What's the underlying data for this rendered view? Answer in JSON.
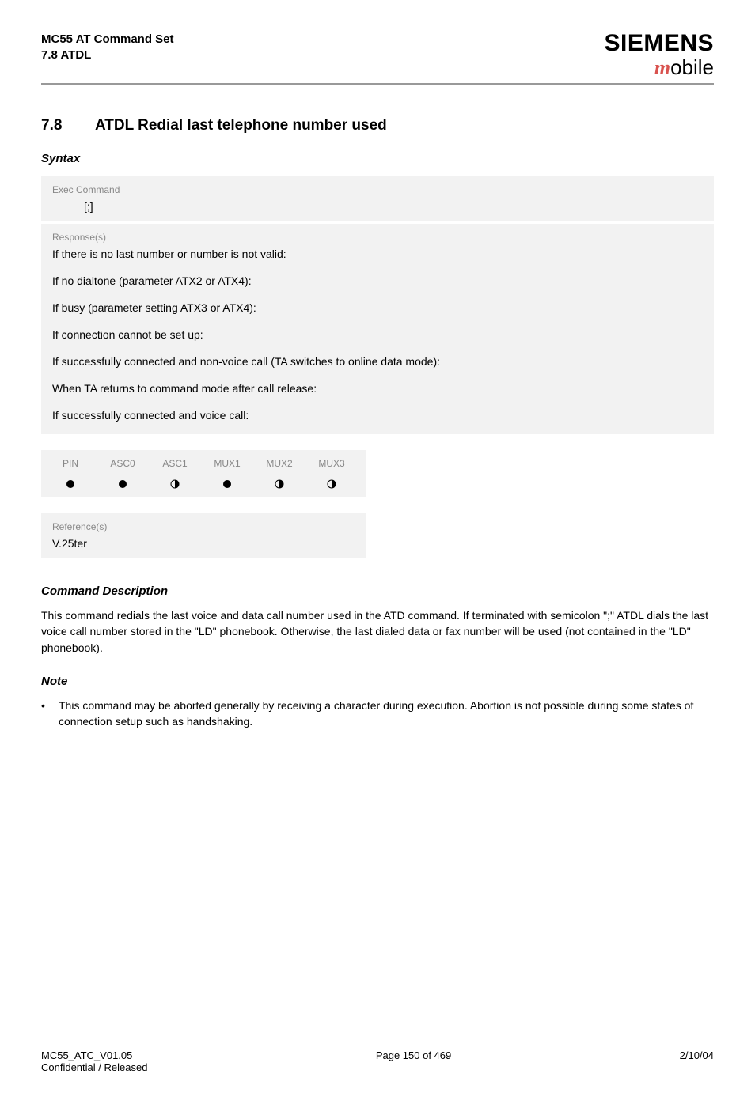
{
  "header": {
    "left_line1": "MC55 AT Command Set",
    "left_line2": "7.8 ATDL",
    "brand": "SIEMENS",
    "subbrand_m": "m",
    "subbrand_rest": "obile"
  },
  "section": {
    "number": "7.8",
    "title": "ATDL   Redial last telephone number used"
  },
  "syntax_label": "Syntax",
  "exec": {
    "label": "Exec Command",
    "cmd": "[;]"
  },
  "response": {
    "label": "Response(s)",
    "lines": [
      "If there is no last number or number is not valid:",
      "If no dialtone (parameter ATX2 or ATX4):",
      "If busy (parameter setting ATX3 or ATX4):",
      "If connection cannot be set up:",
      "If successfully connected and non-voice call (TA switches to online data mode):",
      "When TA returns to command mode after call release:",
      "If successfully connected and voice call:"
    ]
  },
  "channels": {
    "headers": [
      "PIN",
      "ASC0",
      "ASC1",
      "MUX1",
      "MUX2",
      "MUX3"
    ],
    "states": [
      "full",
      "full",
      "half",
      "full",
      "half",
      "half"
    ]
  },
  "reference": {
    "label": "Reference(s)",
    "value": "V.25ter"
  },
  "cmd_desc": {
    "heading": "Command Description",
    "text": "This command redials the last voice and data call number used in the ATD command. If terminated with semicolon \";\" ATDL dials the last voice call number stored in the \"LD\" phonebook. Otherwise, the last dialed data or fax number will be used (not contained in the \"LD\" phonebook)."
  },
  "note": {
    "heading": "Note",
    "bullet": "•",
    "text": "This command may be aborted generally by receiving a character during execution. Abortion is not possible during some states of connection setup such as handshaking."
  },
  "footer": {
    "left_line1": "MC55_ATC_V01.05",
    "left_line2": "Confidential / Released",
    "center": "Page 150 of 469",
    "right": "2/10/04"
  }
}
